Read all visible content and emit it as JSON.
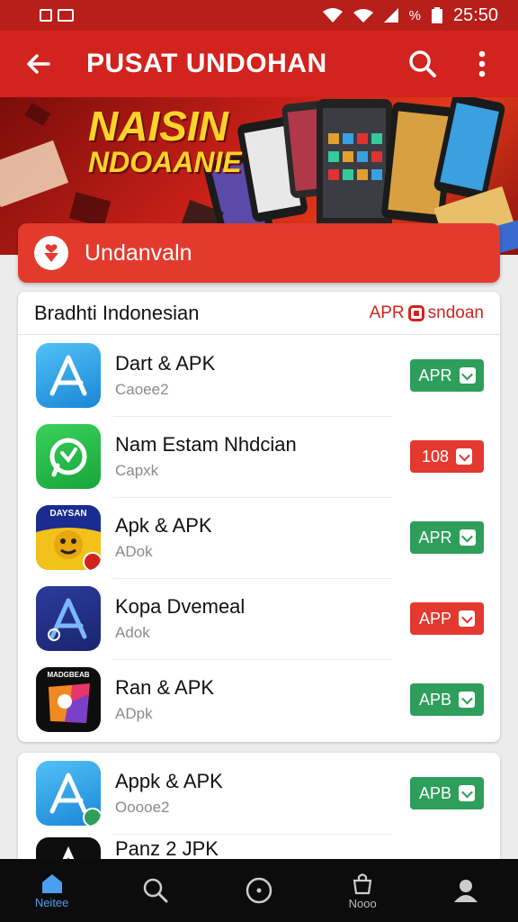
{
  "status_bar": {
    "time": "25:50",
    "battery_symbol": "%"
  },
  "app_bar": {
    "title": "PUSAT UNDOHAN"
  },
  "banner": {
    "headline_line1": "NAISIN",
    "headline_line2": "NDOAANIE"
  },
  "cta": {
    "label": "Undanvaln"
  },
  "section": {
    "title": "Bradhti Indonesian",
    "link_label": "APR",
    "link_suffix": "sndoan",
    "apps": [
      {
        "name": "Dart & APK",
        "subtitle": "Caoee2",
        "button": "APR",
        "button_color": "green",
        "icon": "blue-a-icon"
      },
      {
        "name": "Nam Estam Nhdcian",
        "subtitle": "Capxk",
        "button": "108",
        "button_color": "red",
        "icon": "green-whatsapp-icon"
      },
      {
        "name": "Apk & APK",
        "subtitle": "ADok",
        "button": "APR",
        "button_color": "green",
        "icon": "yellow-face-icon",
        "icon_caption": "DAYSAN"
      },
      {
        "name": "Kopa Dvemeal",
        "subtitle": "Adok",
        "button": "APP",
        "button_color": "red",
        "icon": "navy-a-icon"
      },
      {
        "name": "Ran & APK",
        "subtitle": "ADpk",
        "button": "APB",
        "button_color": "green",
        "icon": "colorful-square-icon",
        "icon_caption": "MADGBEAB"
      }
    ]
  },
  "section2": {
    "apps": [
      {
        "name": "Appk & APK",
        "subtitle": "Ooooe2",
        "button": "APB",
        "button_color": "green",
        "icon": "blue-a-icon"
      },
      {
        "name": "Panz 2 JPK",
        "icon": "black-a-icon"
      }
    ]
  },
  "bottom_nav": [
    {
      "label": "Neitee",
      "icon": "home-icon",
      "active": true
    },
    {
      "label": "",
      "icon": "search-icon"
    },
    {
      "label": "",
      "icon": "compass-icon"
    },
    {
      "label": "Nooo",
      "icon": "bag-icon"
    },
    {
      "label": "",
      "icon": "profile-icon"
    }
  ],
  "colors": {
    "primary": "#d3231e",
    "green": "#2e9e5b",
    "red": "#e3392f",
    "nav_active": "#4b9ff0"
  }
}
